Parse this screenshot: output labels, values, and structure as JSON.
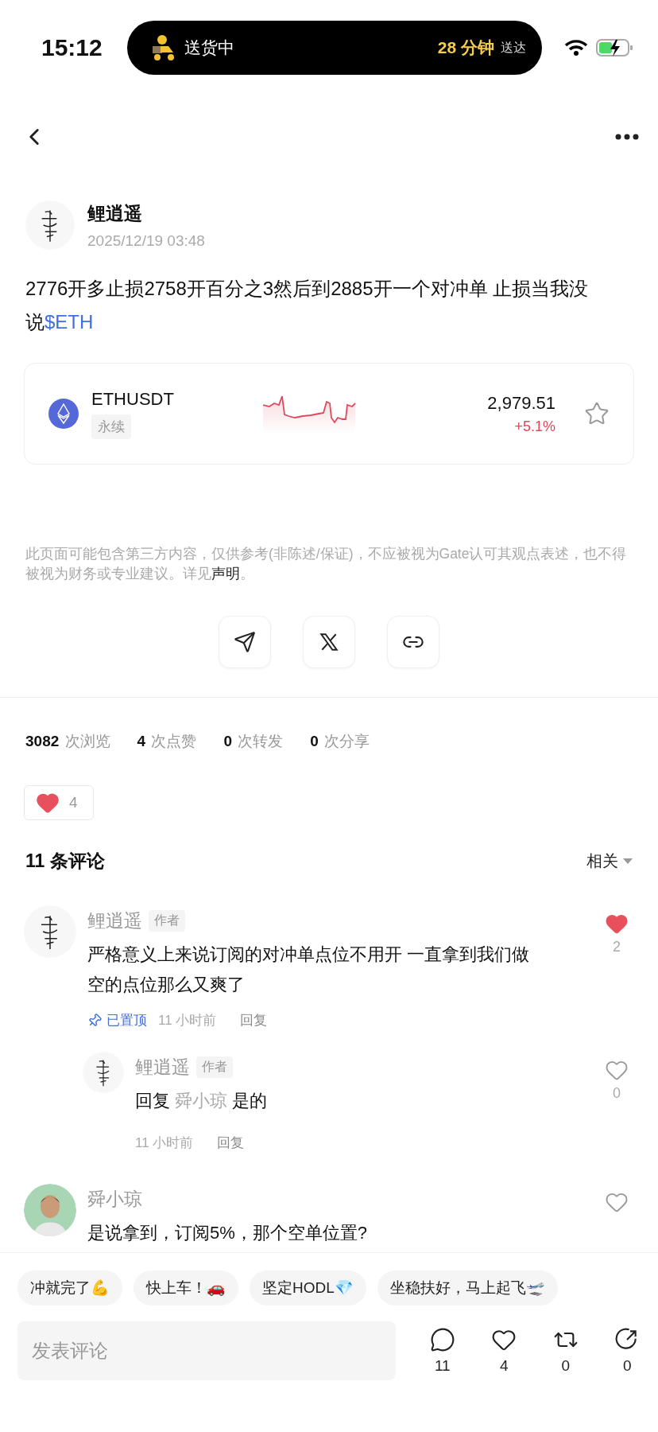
{
  "status_bar": {
    "time": "15:12",
    "activity": {
      "label": "送货中",
      "eta": "28 分钟",
      "eta_suffix": "送达"
    }
  },
  "post": {
    "author": "鲤逍遥",
    "date": "2025/12/19 03:48",
    "text": "2776开多止损2758开百分之3然后到2885开一个对冲单 止损当我没说",
    "tag": "$ETH"
  },
  "ticker": {
    "symbol": "ETHUSDT",
    "type": "永续",
    "price": "2,979.51",
    "change": "+5.1%",
    "starred": false
  },
  "disclaimer": {
    "text": "此页面可能包含第三方内容，仅供参考(非陈述/保证)，不应被视为Gate认可其观点表述，也不得被视为财务或专业建议。详见",
    "link": "声明",
    "end": "。"
  },
  "share_buttons": [
    {
      "kind": "telegram"
    },
    {
      "kind": "x"
    },
    {
      "kind": "link"
    }
  ],
  "stats": [
    "**3082** 次浏览",
    "**4** 次点赞",
    "**0** 次转发",
    "**0** 次分享"
  ],
  "reaction": {
    "count": "4"
  },
  "comments_header": {
    "title": "11 条评论",
    "sort": "相关"
  },
  "comments": [
    {
      "avatar": {
        "kind": "picture"
      },
      "author": "鲤逍遥",
      "badge": "作者",
      "text": "严格意义上来说订阅的对冲单点位不用开 一直拿到我们做空的点位那么又爽了",
      "pinned": true,
      "pin_label": "已置顶",
      "time": "11 小时前",
      "reply_label": "回复",
      "likes": "2",
      "liked": true,
      "replies": [
        {
          "avatar": {
            "kind": "picture"
          },
          "author": "鲤逍遥",
          "badge": "作者",
          "reply_prefix": "回复",
          "reply_to": "舜小琼",
          "text": "是的",
          "time": "11 小时前",
          "reply_label": "回复",
          "likes": "0",
          "liked": false
        }
      ]
    },
    {
      "avatar": {
        "kind": "picture"
      },
      "author": "舜小琼",
      "text": "是说拿到，订阅5%，那个空单位置?",
      "liked": false
    }
  ],
  "quick_replies": [
    "冲就完了💪",
    "快上车！🚗",
    "坚定HODL💎",
    "坐稳扶好，马上起飞🛫"
  ],
  "composer": {
    "placeholder": "发表评论"
  },
  "actions": [
    {
      "kind": "comment",
      "count": "11"
    },
    {
      "kind": "like",
      "count": "4"
    },
    {
      "kind": "repost",
      "count": "0"
    },
    {
      "kind": "share",
      "count": "0"
    }
  ]
}
